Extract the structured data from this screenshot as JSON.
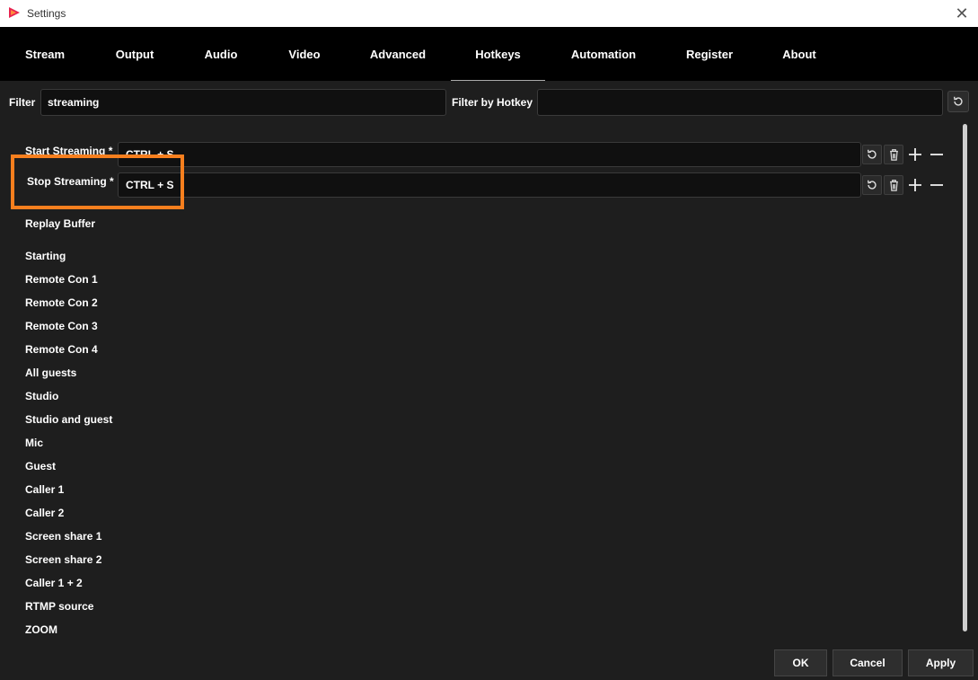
{
  "window": {
    "title": "Settings"
  },
  "tabs": [
    {
      "label": "Stream"
    },
    {
      "label": "Output"
    },
    {
      "label": "Audio"
    },
    {
      "label": "Video"
    },
    {
      "label": "Advanced"
    },
    {
      "label": "Hotkeys",
      "active": true
    },
    {
      "label": "Automation"
    },
    {
      "label": "Register"
    },
    {
      "label": "About"
    }
  ],
  "filter": {
    "label": "Filter",
    "value": "streaming",
    "hotkey_label": "Filter by Hotkey",
    "hotkey_value": ""
  },
  "hotkeys": [
    {
      "label": "Start Streaming *",
      "value": "CTRL + S"
    },
    {
      "label": "Stop Streaming *",
      "value": "CTRL + S"
    }
  ],
  "items": [
    "Replay Buffer",
    "Starting",
    "Remote Con 1",
    "Remote Con 2",
    "Remote Con 3",
    "Remote Con 4",
    "All guests",
    "Studio",
    "Studio and guest",
    "Mic",
    "Guest",
    "Caller 1",
    "Caller 2",
    "Screen share 1",
    "Screen share 2",
    "Caller 1 + 2",
    "RTMP source",
    "ZOOM"
  ],
  "buttons": {
    "ok": "OK",
    "cancel": "Cancel",
    "apply": "Apply"
  },
  "colors": {
    "highlight": "#f77f1e",
    "background": "#1e1e1e",
    "tabbar": "#000000"
  }
}
